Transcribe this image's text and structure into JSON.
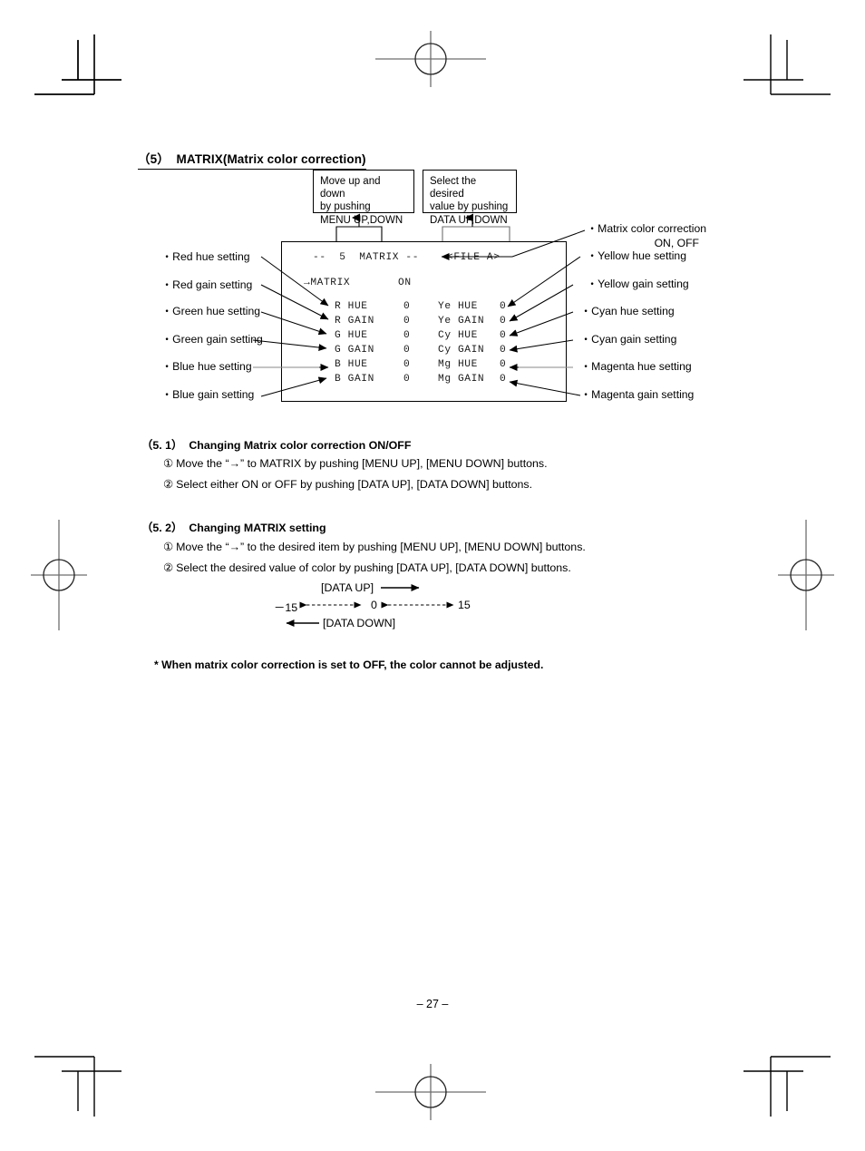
{
  "document": {
    "section_number": "（5）",
    "section_title": "MATRIX(Matrix color correction)",
    "page_number": "– 27 –"
  },
  "callouts": [
    {
      "id": "menu-updown",
      "text": "Move up and down\nby pushing\nMENU UP,DOWN"
    },
    {
      "id": "data-updown",
      "text": "Select the desired\nvalue by pushing\nDATA UP,DOWN"
    }
  ],
  "monitor": {
    "header": "--  5  MATRIX --",
    "file": "<FILE A>",
    "matrix_label": "→MATRIX",
    "matrix_value": "ON",
    "rows": [
      {
        "left_label": "R HUE",
        "left_value": "0",
        "right_label": "Ye HUE",
        "right_value": "0"
      },
      {
        "left_label": "R GAIN",
        "left_value": "0",
        "right_label": "Ye GAIN",
        "right_value": "0"
      },
      {
        "left_label": "G HUE",
        "left_value": "0",
        "right_label": "Cy HUE",
        "right_value": "0"
      },
      {
        "left_label": "G GAIN",
        "left_value": "0",
        "right_label": "Cy GAIN",
        "right_value": "0"
      },
      {
        "left_label": "B HUE",
        "left_value": "0",
        "right_label": "Mg HUE",
        "right_value": "0"
      },
      {
        "left_label": "B GAIN",
        "left_value": "0",
        "right_label": "Mg GAIN",
        "right_value": "0"
      }
    ]
  },
  "left_labels": [
    {
      "text": "・Red hue setting"
    },
    {
      "text": "・Red gain setting"
    },
    {
      "text": "・Green hue setting"
    },
    {
      "text": "・Green gain setting"
    },
    {
      "text": "・Blue hue setting"
    },
    {
      "text": "・Blue gain setting"
    }
  ],
  "right_labels": [
    {
      "text": "・Matrix color correction",
      "sub": "ON, OFF"
    },
    {
      "text": "・Yellow hue setting"
    },
    {
      "text": "・Yellow gain setting"
    },
    {
      "text": "・Cyan hue setting"
    },
    {
      "text": "・Cyan gain setting"
    },
    {
      "text": "・Magenta hue setting"
    },
    {
      "text": "・Magenta gain setting"
    }
  ],
  "procedures": [
    {
      "number": "（5. 1）",
      "title": "Changing Matrix color correction ON/OFF",
      "steps": [
        {
          "marker": "①",
          "text": "Move the “→” to MATRIX by pushing [MENU UP], [MENU DOWN] buttons."
        },
        {
          "marker": "②",
          "text": "Select either ON or OFF by pushing [DATA UP], [DATA DOWN] buttons."
        }
      ]
    },
    {
      "number": "（5. 2）",
      "title": "Changing MATRIX setting",
      "steps": [
        {
          "marker": "①",
          "text": "Move the “→” to the desired item by pushing [MENU UP], [MENU DOWN] buttons."
        },
        {
          "marker": "②",
          "text": "Select the desired value of color by pushing [DATA UP], [DATA DOWN] buttons."
        }
      ]
    }
  ],
  "range_diagram": {
    "data_up_label": "[DATA UP]",
    "data_down_label": "[DATA DOWN]",
    "min_value": "－15",
    "center_value": "0",
    "max_value": "15"
  },
  "note": "* When matrix color correction is set to OFF, the color cannot be adjusted."
}
